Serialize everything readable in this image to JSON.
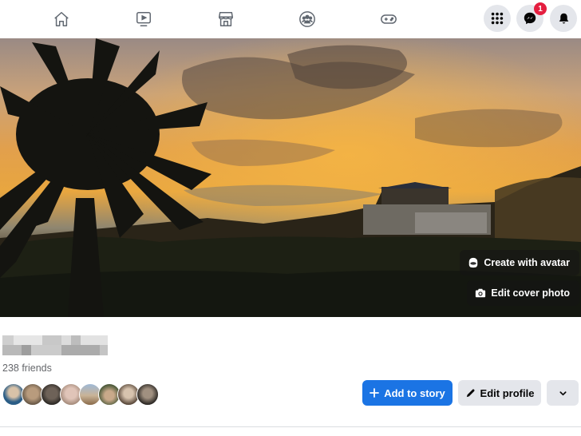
{
  "topbar": {
    "nav_icons": [
      {
        "name": "home-icon",
        "label": "Home"
      },
      {
        "name": "watch-icon",
        "label": "Watch"
      },
      {
        "name": "marketplace-icon",
        "label": "Marketplace"
      },
      {
        "name": "groups-icon",
        "label": "Groups"
      },
      {
        "name": "gaming-icon",
        "label": "Gaming"
      }
    ],
    "menu_icon": "grid-menu-icon",
    "messenger_icon": "messenger-icon",
    "messenger_badge": "1",
    "notifications_icon": "bell-icon"
  },
  "cover": {
    "create_avatar_label": "Create with avatar",
    "edit_cover_label": "Edit cover photo"
  },
  "profile": {
    "name": "",
    "friends_count": "238 friends",
    "friend_avatars_count": 8
  },
  "actions": {
    "add_story_label": "Add to story",
    "edit_profile_label": "Edit profile"
  },
  "colors": {
    "primary": "#1b74e4",
    "secondary_bg": "#e4e6eb",
    "badge": "#e41e3f",
    "muted_text": "#65676b"
  }
}
